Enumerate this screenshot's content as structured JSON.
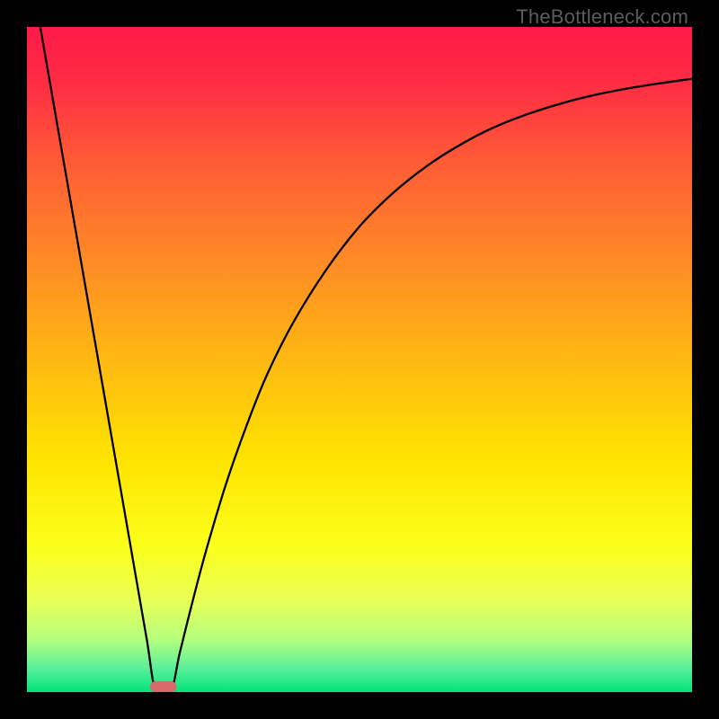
{
  "watermark": "TheBottleneck.com",
  "chart_data": {
    "type": "line",
    "title": "",
    "xlabel": "",
    "ylabel": "",
    "xlim": [
      0,
      100
    ],
    "ylim": [
      0,
      100
    ],
    "background_gradient": {
      "stops": [
        {
          "offset": 0.0,
          "color": "#ff1a48"
        },
        {
          "offset": 0.08,
          "color": "#ff2b44"
        },
        {
          "offset": 0.2,
          "color": "#ff5a36"
        },
        {
          "offset": 0.35,
          "color": "#ff8a26"
        },
        {
          "offset": 0.5,
          "color": "#ffb812"
        },
        {
          "offset": 0.65,
          "color": "#ffe400"
        },
        {
          "offset": 0.78,
          "color": "#fbff1a"
        },
        {
          "offset": 0.86,
          "color": "#eaff55"
        },
        {
          "offset": 0.92,
          "color": "#b6ff7d"
        },
        {
          "offset": 0.965,
          "color": "#58f09a"
        },
        {
          "offset": 1.0,
          "color": "#00e47a"
        }
      ]
    },
    "series": [
      {
        "name": "bottleneck-curve",
        "stroke": "#000000",
        "stroke_width": 2.3,
        "points": [
          {
            "x": 2.0,
            "y": 100.0
          },
          {
            "x": 4.0,
            "y": 88.5
          },
          {
            "x": 6.0,
            "y": 77.0
          },
          {
            "x": 8.0,
            "y": 65.5
          },
          {
            "x": 10.0,
            "y": 54.0
          },
          {
            "x": 12.0,
            "y": 42.5
          },
          {
            "x": 14.0,
            "y": 31.0
          },
          {
            "x": 16.0,
            "y": 19.5
          },
          {
            "x": 18.0,
            "y": 8.0
          },
          {
            "x": 19.4,
            "y": 0.0
          },
          {
            "x": 21.6,
            "y": 0.0
          },
          {
            "x": 23.0,
            "y": 6.0
          },
          {
            "x": 25.0,
            "y": 14.0
          },
          {
            "x": 27.0,
            "y": 21.5
          },
          {
            "x": 30.0,
            "y": 31.5
          },
          {
            "x": 33.0,
            "y": 40.0
          },
          {
            "x": 36.0,
            "y": 47.5
          },
          {
            "x": 40.0,
            "y": 55.5
          },
          {
            "x": 45.0,
            "y": 63.5
          },
          {
            "x": 50.0,
            "y": 70.0
          },
          {
            "x": 55.0,
            "y": 75.0
          },
          {
            "x": 60.0,
            "y": 79.0
          },
          {
            "x": 65.0,
            "y": 82.2
          },
          {
            "x": 70.0,
            "y": 84.8
          },
          {
            "x": 75.0,
            "y": 86.8
          },
          {
            "x": 80.0,
            "y": 88.4
          },
          {
            "x": 85.0,
            "y": 89.7
          },
          {
            "x": 90.0,
            "y": 90.7
          },
          {
            "x": 95.0,
            "y": 91.5
          },
          {
            "x": 100.0,
            "y": 92.2
          }
        ]
      }
    ],
    "marker": {
      "name": "optimal-marker",
      "shape": "rounded-bar",
      "fill": "#d66a6a",
      "x_start": 18.5,
      "x_end": 22.5,
      "y": 0.0,
      "height_pct": 1.6
    }
  }
}
